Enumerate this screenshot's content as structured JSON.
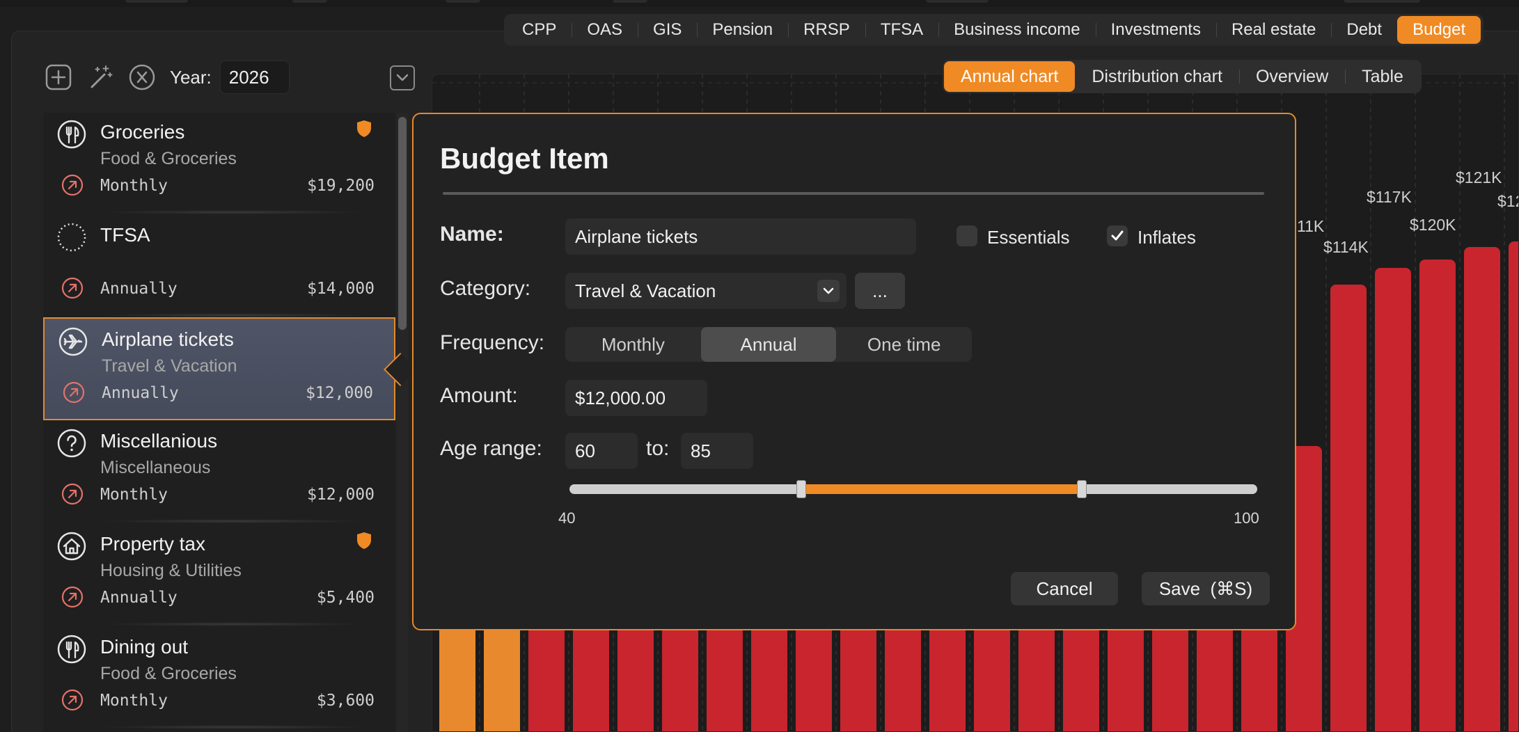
{
  "top_tabs": [
    "CPP",
    "OAS",
    "GIS",
    "Pension",
    "RRSP",
    "TFSA",
    "Business income",
    "Investments",
    "Real estate",
    "Debt",
    "Budget"
  ],
  "top_tabs_active": "Budget",
  "toolbar": {
    "year_label": "Year:",
    "year_value": "2026"
  },
  "toolbar_icons": [
    "add-icon",
    "magic-wand-icon",
    "clear-icon",
    "collapse-icon"
  ],
  "view_tabs": [
    "Annual chart",
    "Distribution chart",
    "Overview",
    "Table"
  ],
  "view_tabs_active": "Annual chart",
  "items": [
    {
      "name": "Groceries",
      "category": "Food & Groceries",
      "frequency": "Monthly",
      "amount": "$19,200",
      "icon": "fork-knife-icon",
      "essential": true,
      "selected": false
    },
    {
      "name": "TFSA",
      "category": "",
      "frequency": "Annually",
      "amount": "$14,000",
      "icon": "dotted-circle-icon",
      "essential": false,
      "selected": false
    },
    {
      "name": "Airplane tickets",
      "category": "Travel & Vacation",
      "frequency": "Annually",
      "amount": "$12,000",
      "icon": "airplane-icon",
      "essential": false,
      "selected": true
    },
    {
      "name": "Miscellanious",
      "category": "Miscellaneous",
      "frequency": "Monthly",
      "amount": "$12,000",
      "icon": "question-icon",
      "essential": false,
      "selected": false
    },
    {
      "name": "Property tax",
      "category": "Housing & Utilities",
      "frequency": "Annually",
      "amount": "$5,400",
      "icon": "house-icon",
      "essential": true,
      "selected": false
    },
    {
      "name": "Dining out",
      "category": "Food & Groceries",
      "frequency": "Monthly",
      "amount": "$3,600",
      "icon": "fork-knife-icon",
      "essential": false,
      "selected": false
    }
  ],
  "popover": {
    "title": "Budget Item",
    "name_label": "Name:",
    "name_value": "Airplane tickets",
    "essentials_label": "Essentials",
    "essentials_checked": false,
    "inflates_label": "Inflates",
    "inflates_checked": true,
    "category_label": "Category:",
    "category_value": "Travel & Vacation",
    "more_label": "...",
    "frequency_label": "Frequency:",
    "frequency_options": [
      "Monthly",
      "Annual",
      "One time"
    ],
    "frequency_selected": "Annual",
    "amount_label": "Amount:",
    "amount_value": "$12,000.00",
    "age_label": "Age range:",
    "age_from": "60",
    "to_label": "to:",
    "age_to": "85",
    "slider_min": "40",
    "slider_max": "100",
    "cancel_label": "Cancel",
    "save_label": "Save  (⌘S)"
  },
  "chart_data": {
    "type": "bar",
    "visible_data_labels": [
      "11K",
      "$114K",
      "$117K",
      "$120K",
      "$121K",
      "$12"
    ],
    "series_colors": [
      "#e8892e",
      "#c8252f"
    ]
  }
}
